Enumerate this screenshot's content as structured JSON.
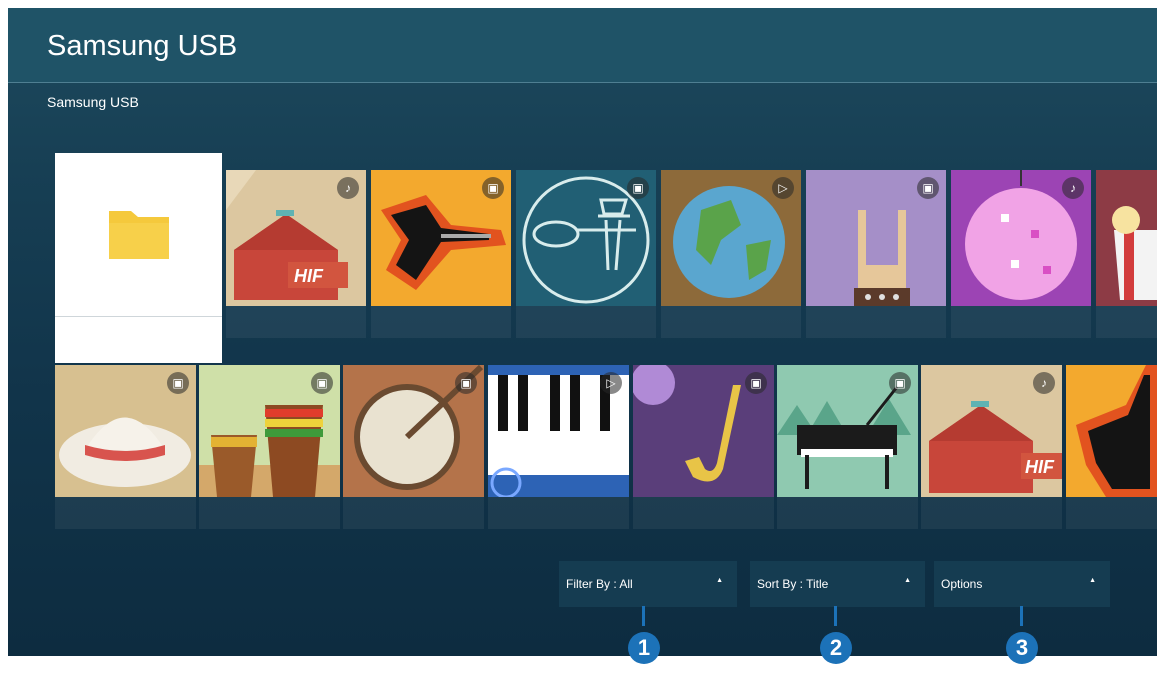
{
  "header": {
    "title": "Samsung USB"
  },
  "breadcrumb": "Samsung USB",
  "row1": [
    {
      "kind": "folder",
      "badge_icon": ""
    },
    {
      "kind": "music",
      "badge_icon": "music-note-icon"
    },
    {
      "kind": "photo",
      "badge_icon": "photo-icon"
    },
    {
      "kind": "photo",
      "badge_icon": "photo-icon"
    },
    {
      "kind": "video",
      "badge_icon": "play-icon"
    },
    {
      "kind": "photo",
      "badge_icon": "photo-icon"
    },
    {
      "kind": "music",
      "badge_icon": "music-note-icon"
    },
    {
      "kind": "photo",
      "badge_icon": ""
    }
  ],
  "row2": [
    {
      "kind": "photo",
      "badge_icon": "photo-icon"
    },
    {
      "kind": "photo",
      "badge_icon": "photo-icon"
    },
    {
      "kind": "photo",
      "badge_icon": "photo-icon"
    },
    {
      "kind": "video",
      "badge_icon": "play-icon"
    },
    {
      "kind": "photo",
      "badge_icon": "photo-icon"
    },
    {
      "kind": "photo",
      "badge_icon": "photo-icon"
    },
    {
      "kind": "music",
      "badge_icon": "music-note-icon"
    },
    {
      "kind": "photo",
      "badge_icon": ""
    }
  ],
  "tile_text": {
    "hifi": "HIF"
  },
  "controls": {
    "filter_label": "Filter By : All",
    "sort_label": "Sort By : Title",
    "options_label": "Options"
  },
  "callouts": [
    "1",
    "2",
    "3"
  ],
  "colors": {
    "accent": "#1c72b8",
    "background": "#11344a",
    "header": "#1f5367",
    "folder": "#f5c93c"
  }
}
